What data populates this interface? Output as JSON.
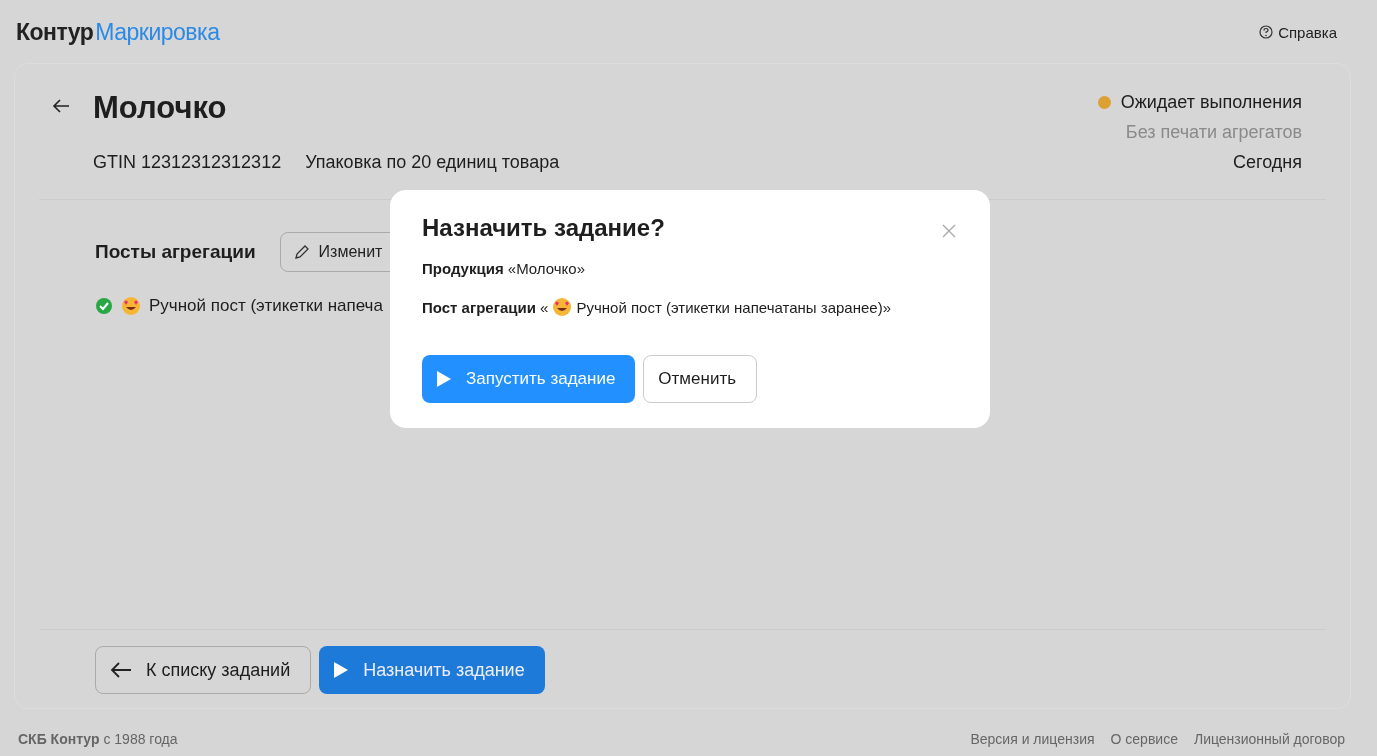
{
  "header": {
    "logo_main": "Контур",
    "logo_product": "Маркировка",
    "help_link": "Справка"
  },
  "task": {
    "title": "Молочко",
    "gtin": "GTIN 12312312312312",
    "packaging": "Упаковка по 20 единиц товара",
    "status": {
      "text": "Ожидает выполнения",
      "color": "#dca033"
    },
    "print_mode": "Без печати агрегатов",
    "date": "Сегодня"
  },
  "posts": {
    "heading": "Посты агрегации",
    "edit_button": "Изменит",
    "items": [
      {
        "label": "Ручной пост (этикетки напеча",
        "checked": true
      }
    ]
  },
  "actions": {
    "back_button": "К списку заданий",
    "assign_button": "Назначить задание"
  },
  "footer": {
    "company": "**СКБ Контур** с 1988 года",
    "links": [
      "Версия и лицензия",
      "О сервисе",
      "Лицензионный договор"
    ]
  },
  "dialog": {
    "title": "Назначить задание?",
    "product_line": "**Продукция** «Молочко»",
    "post_label": "**Пост агрегации** «",
    "post_value": "Ручной пост (этикетки напечатаны заранее)»",
    "confirm_button": "Запустить задание",
    "cancel_button": "Отменить"
  }
}
